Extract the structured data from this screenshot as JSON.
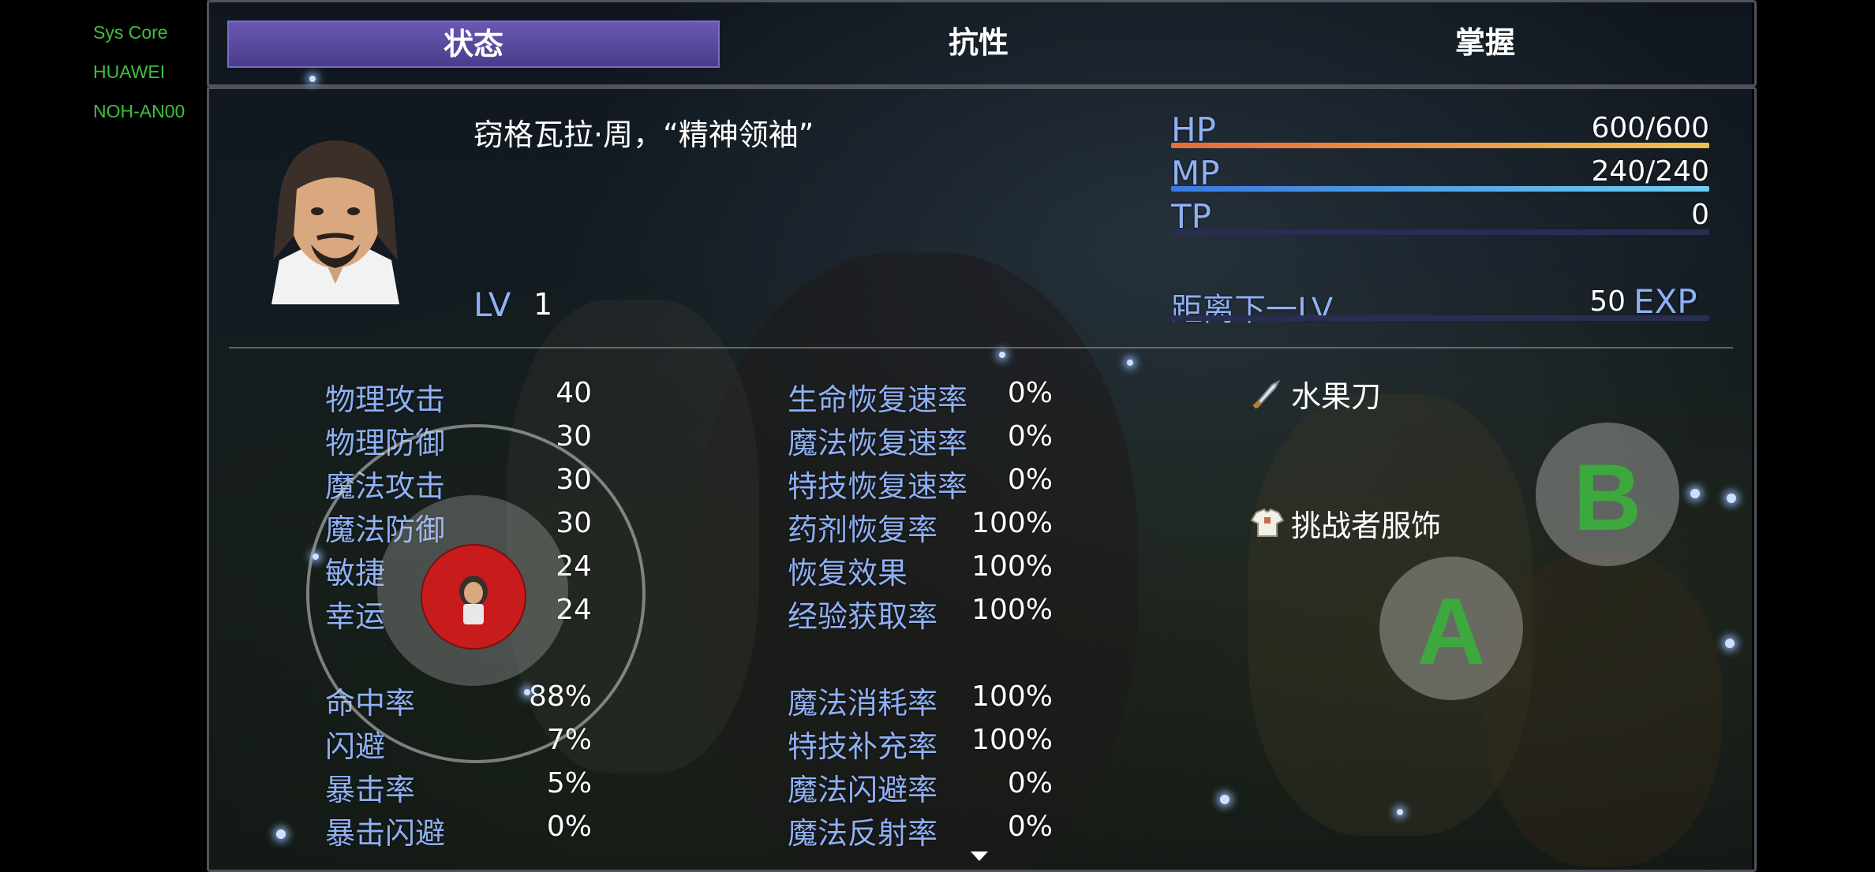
{
  "system_overlay": {
    "line1": "Sys Core",
    "line2": "HUAWEI",
    "line3": "NOH-AN00"
  },
  "tabs": [
    {
      "label": "状态",
      "active": true
    },
    {
      "label": "抗性",
      "active": false
    },
    {
      "label": "掌握",
      "active": false
    }
  ],
  "actor": {
    "name": "窃格瓦拉·周，“精神领袖”",
    "level_label": "LV",
    "level": "1"
  },
  "gauges": {
    "hp_label": "HP",
    "hp_value": "600/600",
    "hp_ratio": 1.0,
    "mp_label": "MP",
    "mp_value": "240/240",
    "mp_ratio": 1.0,
    "tp_label": "TP",
    "tp_value": "0",
    "tp_ratio": 0.0,
    "exp_label": "距离下一LV",
    "exp_value": "50",
    "exp_unit": "EXP"
  },
  "params": [
    {
      "label": "物理攻击",
      "value": "40"
    },
    {
      "label": "物理防御",
      "value": "30"
    },
    {
      "label": "魔法攻击",
      "value": "30"
    },
    {
      "label": "魔法防御",
      "value": "30"
    },
    {
      "label": "敏捷",
      "value": "24"
    },
    {
      "label": "幸运",
      "value": "24"
    }
  ],
  "xparams": [
    {
      "label": "命中率",
      "value": "88%"
    },
    {
      "label": "闪避",
      "value": "7%"
    },
    {
      "label": "暴击率",
      "value": "5%"
    },
    {
      "label": "暴击闪避",
      "value": "0%"
    }
  ],
  "sparams_top": [
    {
      "label": "生命恢复速率",
      "value": "0%"
    },
    {
      "label": "魔法恢复速率",
      "value": "0%"
    },
    {
      "label": "特技恢复速率",
      "value": "0%"
    },
    {
      "label": "药剂恢复率",
      "value": "100%"
    },
    {
      "label": "恢复效果",
      "value": "100%"
    },
    {
      "label": "经验获取率",
      "value": "100%"
    }
  ],
  "sparams_bottom": [
    {
      "label": "魔法消耗率",
      "value": "100%"
    },
    {
      "label": "特技补充率",
      "value": "100%"
    },
    {
      "label": "魔法闪避率",
      "value": "0%"
    },
    {
      "label": "魔法反射率",
      "value": "0%"
    }
  ],
  "equipment": [
    {
      "name": "水果刀",
      "icon": "knife-icon"
    },
    {
      "name": "挑战者服饰",
      "icon": "clothing-icon"
    }
  ],
  "controls": {
    "button_a": "A",
    "button_b": "B"
  },
  "colors": {
    "hp": "#e8a040",
    "mp": "#4aa8e8",
    "tab_active": "#5a4aa0",
    "label": "#8fb0f4",
    "button_text": "#3da83d"
  }
}
